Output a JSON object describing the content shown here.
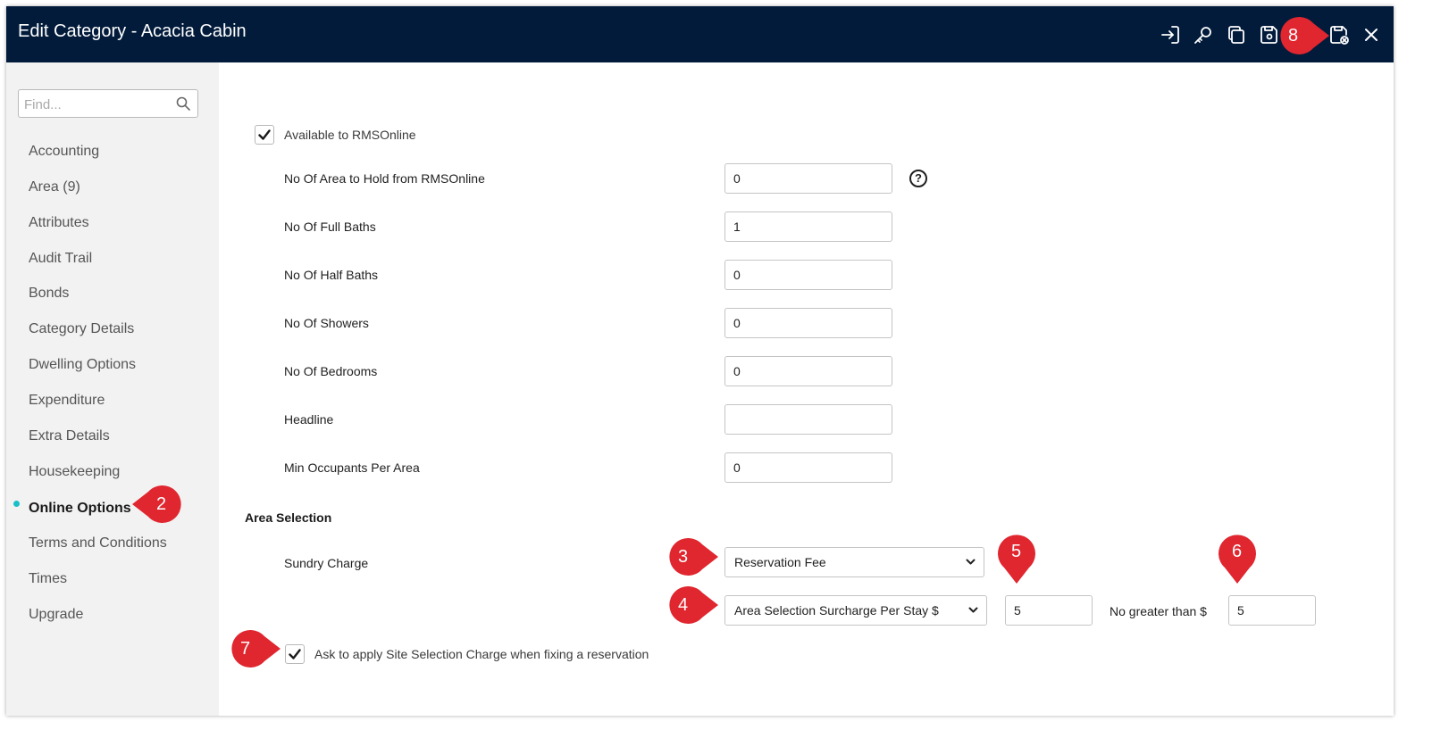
{
  "window": {
    "title": "Edit Category - Acacia Cabin"
  },
  "toolbar": {
    "icons": [
      "sign-in-icon",
      "key-icon",
      "copy-icon",
      "save-icon",
      "save-exit-icon",
      "close-icon"
    ]
  },
  "sidebar": {
    "search": {
      "placeholder": "Find...",
      "value": ""
    },
    "items": [
      {
        "label": "Accounting"
      },
      {
        "label": "Area (9)"
      },
      {
        "label": "Attributes"
      },
      {
        "label": "Audit Trail"
      },
      {
        "label": "Bonds"
      },
      {
        "label": "Category Details"
      },
      {
        "label": "Dwelling Options"
      },
      {
        "label": "Expenditure"
      },
      {
        "label": "Extra Details"
      },
      {
        "label": "Housekeeping"
      },
      {
        "label": "Online Options"
      },
      {
        "label": "Terms and Conditions"
      },
      {
        "label": "Times"
      },
      {
        "label": "Upgrade"
      }
    ],
    "active": "Online Options"
  },
  "form": {
    "available_label": "Available to RMSOnline",
    "available_checked": true,
    "fields": [
      {
        "label": "No Of Area to Hold from RMSOnline",
        "value": "0"
      },
      {
        "label": "No Of Full Baths",
        "value": "1"
      },
      {
        "label": "No Of Half Baths",
        "value": "0"
      },
      {
        "label": "No Of Showers",
        "value": "0"
      },
      {
        "label": "No Of Bedrooms",
        "value": "0"
      },
      {
        "label": "Headline",
        "value": ""
      },
      {
        "label": "Min Occupants Per Area",
        "value": "0"
      }
    ],
    "help_glyph": "?",
    "area_selection": {
      "heading": "Area Selection",
      "sundry_label": "Sundry Charge",
      "sundry_value": "Reservation Fee",
      "surcharge_type": "Area Selection Surcharge Per Stay $",
      "surcharge_amount": "5",
      "max_label": "No greater than $",
      "max_amount": "5"
    },
    "ask_label": "Ask to apply Site Selection Charge when fixing a reservation",
    "ask_checked": true
  },
  "annotations": [
    "2",
    "3",
    "4",
    "5",
    "6",
    "7",
    "8"
  ],
  "colors": {
    "titlebar": "#021b3b",
    "accent_dot": "#19c0c7",
    "badge": "#e0262f"
  }
}
